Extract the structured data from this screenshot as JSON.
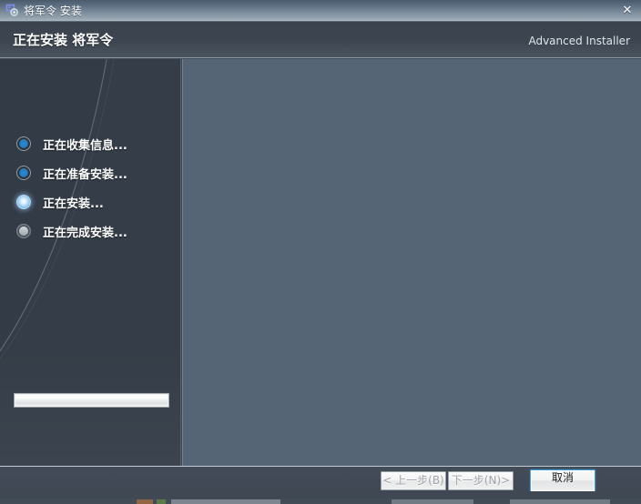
{
  "window": {
    "titlebar": {
      "icon": "installer-icon",
      "title": "将军令 安装",
      "close_label": "✕"
    },
    "header": {
      "title": "正在安装 将军令",
      "brand": "Advanced Installer"
    }
  },
  "sidebar": {
    "steps": [
      {
        "label": "正在收集信息...",
        "state": "done"
      },
      {
        "label": "正在准备安装...",
        "state": "done"
      },
      {
        "label": "正在安装...",
        "state": "active"
      },
      {
        "label": "正在完成安装...",
        "state": "pending"
      }
    ],
    "progress": {
      "value": 0,
      "max": 100
    }
  },
  "footer": {
    "back_label": "< 上一步(B)",
    "next_label": "下一步(N)>",
    "cancel_label": "取消"
  },
  "colors": {
    "titlebar_top": "#4a5b6b",
    "titlebar_bottom": "#a9b5bf",
    "header_bg": "#3d4650",
    "sidebar_bg": "#333b46",
    "main_panel_bg": "#556575",
    "footer_bg": "#424b57",
    "step_done": "#1f7cc7",
    "step_active": "#8fc8f0",
    "step_pending": "#b6bbc0",
    "focus_ring": "#3f9ad6",
    "text_primary": "#ffffff",
    "text_disabled": "#9ea4aa"
  }
}
